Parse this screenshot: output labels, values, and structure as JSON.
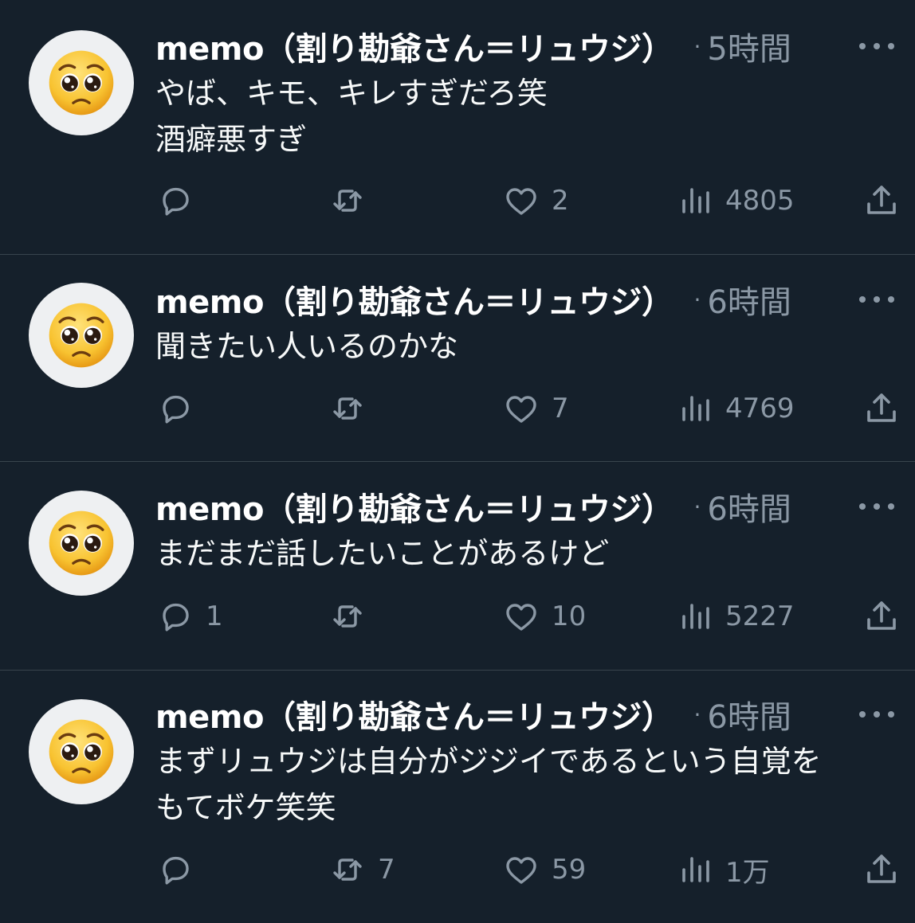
{
  "colors": {
    "background": "#15202b",
    "divider": "#38444d",
    "text": "#f7f9f9",
    "secondary": "#8b98a5"
  },
  "tweets": [
    {
      "avatar_icon": "pleading-face-icon",
      "display_name": "memo（割り勘爺さん＝リュウジ）",
      "separator": "·",
      "time": "5時間",
      "lines": [
        "やば、キモ、キレすぎだろ笑",
        "酒癖悪すぎ"
      ],
      "reply_count": "",
      "retweet_count": "",
      "like_count": "2",
      "view_count": "4805"
    },
    {
      "avatar_icon": "pleading-face-icon",
      "display_name": "memo（割り勘爺さん＝リュウジ）",
      "separator": "·",
      "time": "6時間",
      "lines": [
        "聞きたい人いるのかな"
      ],
      "reply_count": "",
      "retweet_count": "",
      "like_count": "7",
      "view_count": "4769"
    },
    {
      "avatar_icon": "pleading-face-icon",
      "display_name": "memo（割り勘爺さん＝リュウジ）",
      "separator": "·",
      "time": "6時間",
      "lines": [
        "まだまだ話したいことがあるけど"
      ],
      "reply_count": "1",
      "retweet_count": "",
      "like_count": "10",
      "view_count": "5227"
    },
    {
      "avatar_icon": "pleading-face-icon",
      "display_name": "memo（割り勘爺さん＝リュウジ）",
      "separator": "·",
      "time": "6時間",
      "lines": [
        "まずリュウジは自分がジジイであるという自覚を",
        "もてボケ笑笑"
      ],
      "reply_count": "",
      "retweet_count": "7",
      "like_count": "59",
      "view_count": "1万"
    }
  ]
}
